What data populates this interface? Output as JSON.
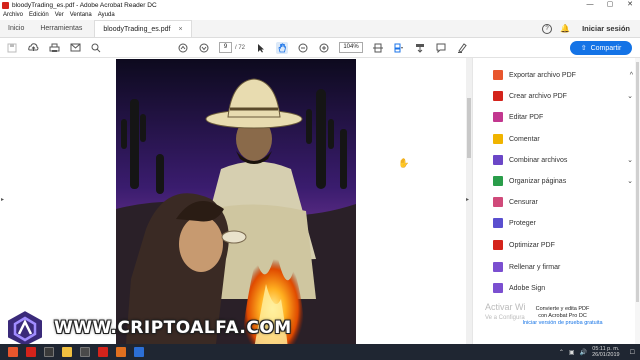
{
  "window": {
    "title": "bloodyTrading_es.pdf - Adobe Acrobat Reader DC",
    "controls": [
      "—",
      "▢",
      "✕"
    ]
  },
  "menu": [
    "Archivo",
    "Edición",
    "Ver",
    "Ventana",
    "Ayuda"
  ],
  "tabs": {
    "home": "Inicio",
    "tools": "Herramientas",
    "file": "bloodyTrading_es.pdf",
    "close": "×"
  },
  "header": {
    "help": "?",
    "login": "Iniciar sesión"
  },
  "toolbar": {
    "page_current": "9",
    "page_total": "/ 72",
    "zoom": "104%"
  },
  "share_label": "Compartir",
  "panel_items": [
    {
      "label": "Exportar archivo PDF",
      "color": "#e8562d",
      "chevron": "^"
    },
    {
      "label": "Crear archivo PDF",
      "color": "#d4231b",
      "chevron": "⌄"
    },
    {
      "label": "Editar PDF",
      "color": "#c2378f",
      "chevron": ""
    },
    {
      "label": "Comentar",
      "color": "#f0b400",
      "chevron": ""
    },
    {
      "label": "Combinar archivos",
      "color": "#6b47c7",
      "chevron": "⌄"
    },
    {
      "label": "Organizar páginas",
      "color": "#2a9d4a",
      "chevron": "⌄"
    },
    {
      "label": "Censurar",
      "color": "#d04a7a",
      "chevron": ""
    },
    {
      "label": "Proteger",
      "color": "#5a4fcf",
      "chevron": ""
    },
    {
      "label": "Optimizar PDF",
      "color": "#d4231b",
      "chevron": ""
    },
    {
      "label": "Rellenar y firmar",
      "color": "#7b4fd0",
      "chevron": ""
    },
    {
      "label": "Adobe Sign",
      "color": "#7b4fd0",
      "chevron": ""
    }
  ],
  "watermark": {
    "line1": "Activar Wi",
    "line2": "Ve a Configura"
  },
  "promo": {
    "line1": "Convierte y edita PDF",
    "line2": "con Acrobat Pro DC",
    "link": "Iniciar versión de prueba gratuita"
  },
  "brand_text": "WWW.CRIPTOALFA.COM",
  "taskbar": {
    "time": "05:11 p. m.",
    "date": "26/01/2019"
  }
}
